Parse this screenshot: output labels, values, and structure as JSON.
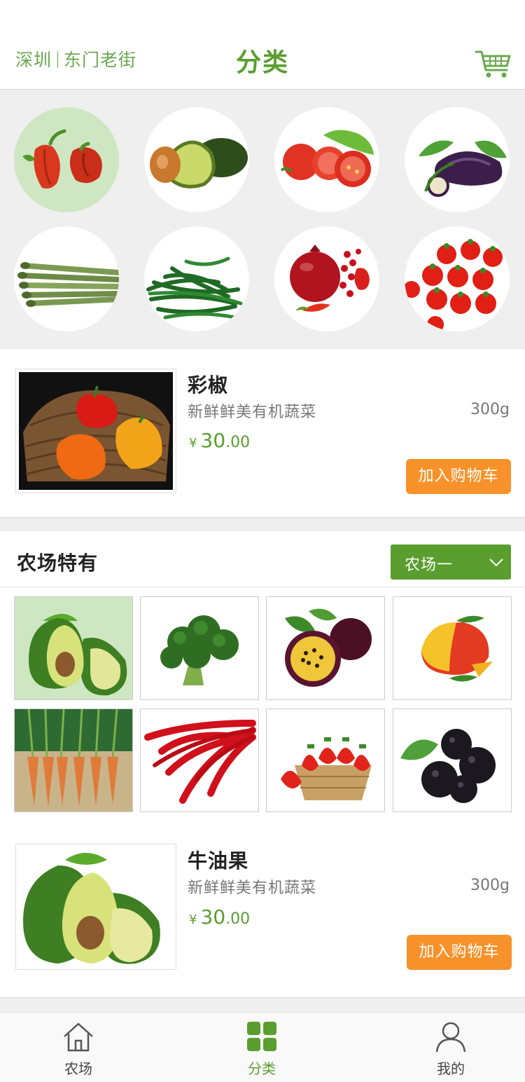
{
  "header": {
    "city": "深圳",
    "district": "东门老街",
    "title": "分类"
  },
  "categories": [
    {
      "name": "pepper-category"
    },
    {
      "name": "avocado-category"
    },
    {
      "name": "tomato-category"
    },
    {
      "name": "eggplant-category"
    },
    {
      "name": "asparagus-category"
    },
    {
      "name": "green-bean-category"
    },
    {
      "name": "pomegranate-category"
    },
    {
      "name": "cherry-tomato-category"
    }
  ],
  "product1": {
    "name": "彩椒",
    "desc": "新鲜鲜美有机蔬菜",
    "weight": "300g",
    "currency": "¥",
    "price_int": "30",
    "price_dec": ".00",
    "button": "加入购物车"
  },
  "farm": {
    "title": "农场特有",
    "selected": "农场一"
  },
  "product2": {
    "name": "牛油果",
    "desc": "新鲜鲜美有机蔬菜",
    "weight": "300g",
    "currency": "¥",
    "price_int": "30",
    "price_dec": ".00",
    "button": "加入购物车"
  },
  "tabs": [
    {
      "label": "农场",
      "icon": "home-icon"
    },
    {
      "label": "分类",
      "icon": "grid-icon"
    },
    {
      "label": "我的",
      "icon": "user-icon"
    }
  ],
  "colors": {
    "accent": "#5a9e2f",
    "button": "#f7922a",
    "active_bg": "#cfe6c3"
  }
}
